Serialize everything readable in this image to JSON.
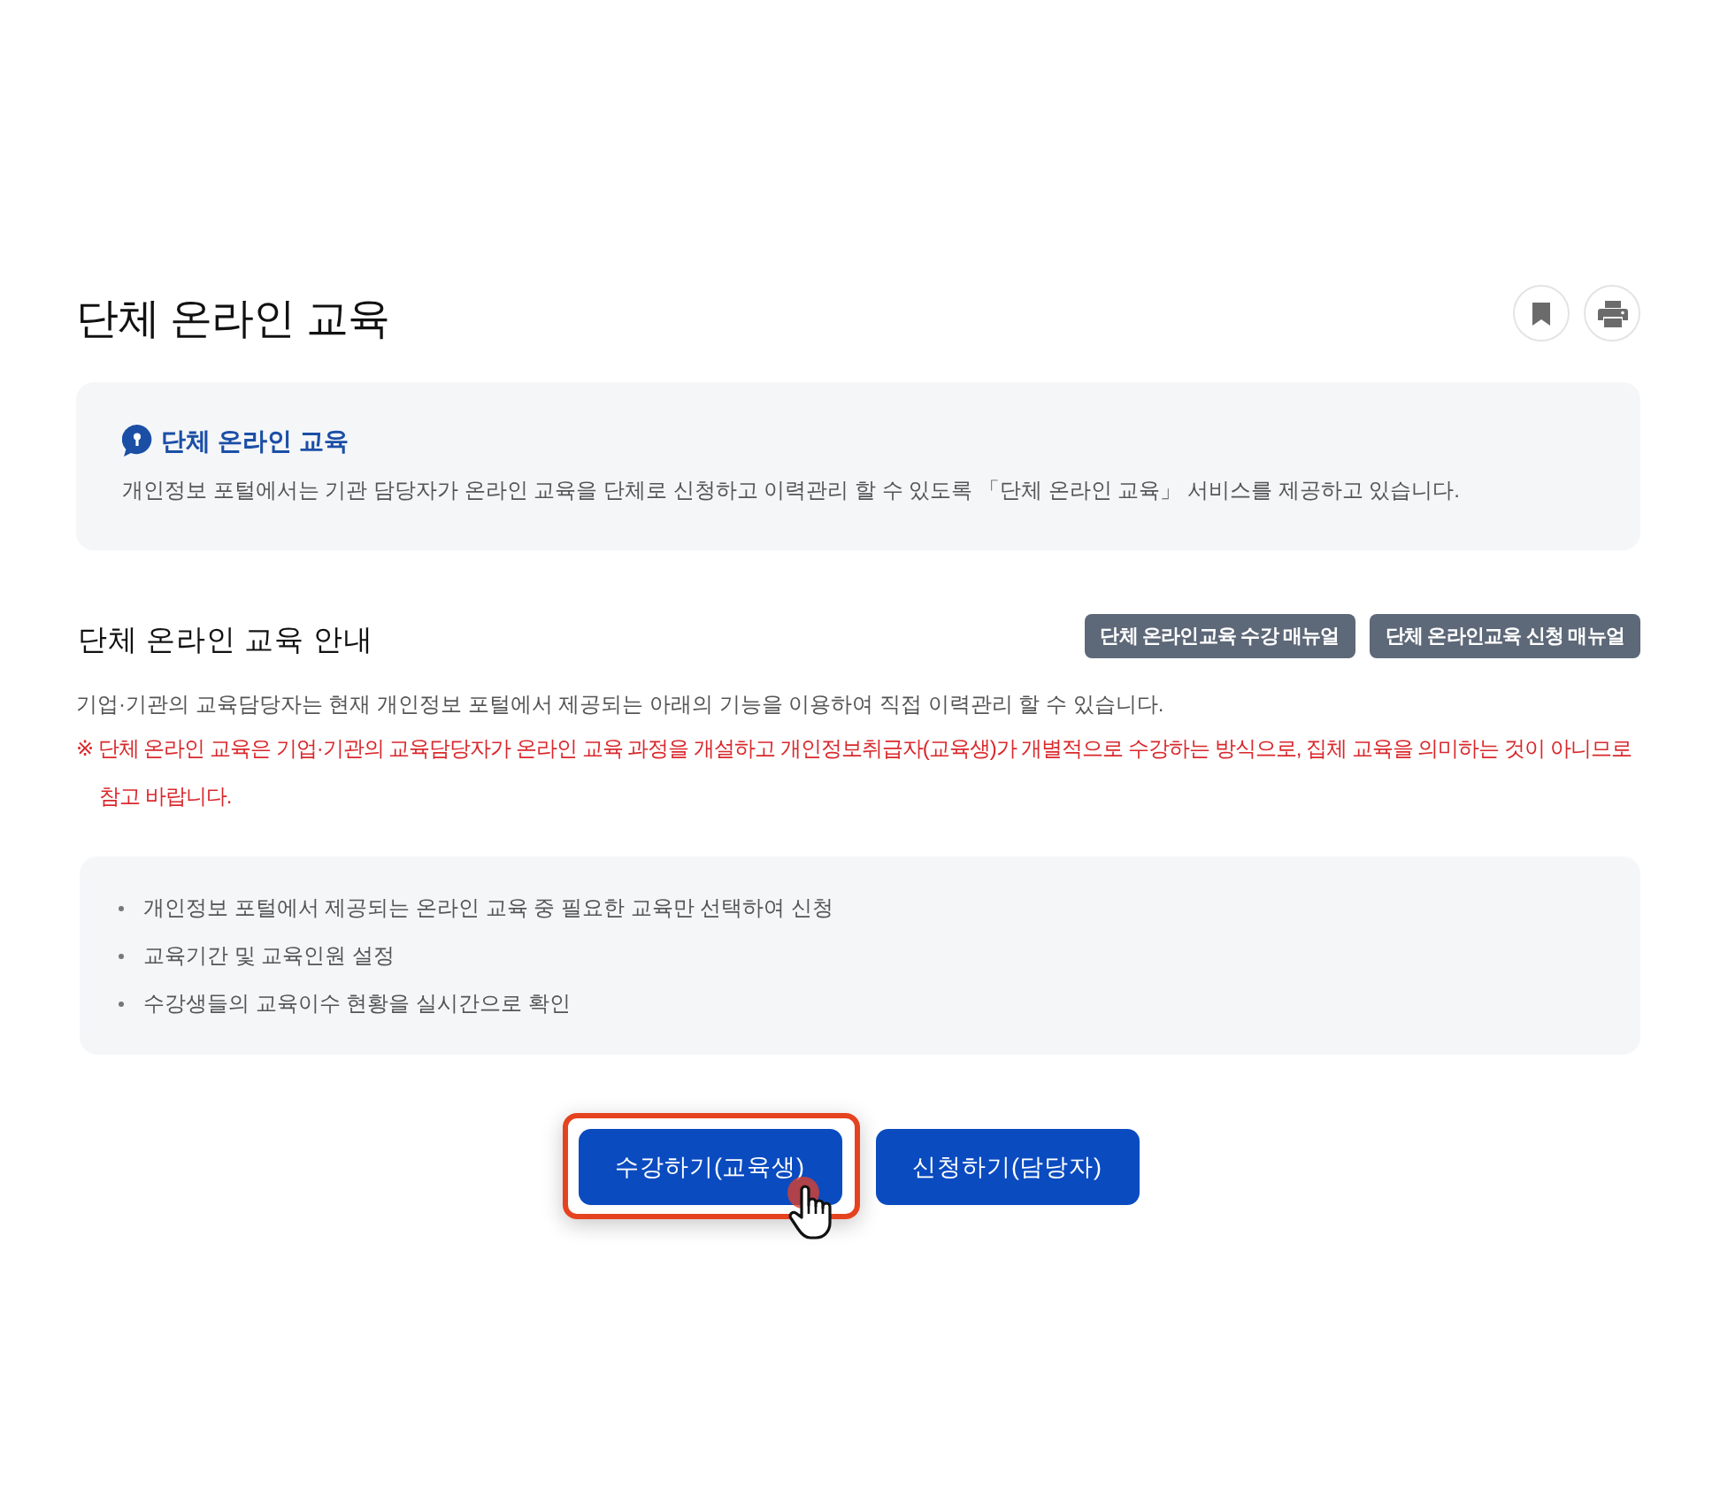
{
  "page": {
    "title": "단체 온라인 교육"
  },
  "intro": {
    "heading": "단체 온라인 교육",
    "text": "개인정보 포털에서는 기관 담당자가 온라인 교육을 단체로 신청하고 이력관리 할 수 있도록 「단체 온라인 교육」 서비스를 제공하고 있습니다."
  },
  "guide": {
    "heading": "단체 온라인 교육 안내",
    "manuals": [
      "단체 온라인교육 수강 매뉴얼",
      "단체 온라인교육 신청 매뉴얼"
    ],
    "text": "기업·기관의 교육담당자는 현재 개인정보 포털에서 제공되는 아래의 기능을 이용하여 직접 이력관리 할 수 있습니다.",
    "notice": "※ 단체 온라인 교육은 기업·기관의 교육담당자가 온라인 교육 과정을 개설하고 개인정보취급자(교육생)가 개별적으로 수강하는 방식으로, 집체 교육을 의미하는 것이 아니므로 참고 바랍니다."
  },
  "features": [
    "개인정보 포털에서 제공되는 온라인 교육 중 필요한 교육만 선택하여 신청",
    "교육기간 및 교육인원 설정",
    "수강생들의 교육이수 현황을 실시간으로 확인"
  ],
  "actions": [
    {
      "label": "수강하기(교육생)",
      "highlighted": true,
      "hovered": true
    },
    {
      "label": "신청하기(담당자)",
      "highlighted": false,
      "hovered": false
    }
  ]
}
